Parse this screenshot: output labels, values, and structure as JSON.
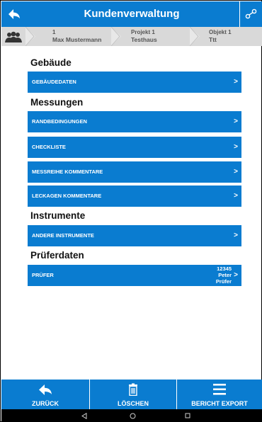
{
  "header": {
    "title": "Kundenverwaltung",
    "back_icon": "arrow-left-icon",
    "share_icon": "share-icon"
  },
  "breadcrumb": {
    "items": [
      {
        "num": "1",
        "name": "Max Mustermann"
      },
      {
        "num": "Projekt 1",
        "name": "Testhaus"
      },
      {
        "num": "Objekt 1",
        "name": "Ttt"
      }
    ]
  },
  "sections": [
    {
      "title": "Gebäude",
      "items": [
        {
          "label": "GEBÄUDEDATEN",
          "arrow": ">"
        }
      ]
    },
    {
      "title": "Messungen",
      "items": [
        {
          "label": "RANDBEDINGUNGEN",
          "arrow": ">"
        },
        {
          "label": "CHECKLISTE",
          "arrow": ">"
        },
        {
          "label": "MESSREIHE KOMMENTARE",
          "arrow": ">"
        },
        {
          "label": "LECKAGEN KOMMENTARE",
          "arrow": ">"
        }
      ]
    },
    {
      "title": "Instrumente",
      "items": [
        {
          "label": "ANDERE INSTRUMENTE",
          "arrow": ">"
        }
      ]
    },
    {
      "title": "Prüferdaten",
      "items": [
        {
          "label": "PRÜFER",
          "arrow": ">",
          "extra": [
            "12345",
            "Peter",
            "Prüfer"
          ]
        }
      ]
    }
  ],
  "bottom_bar": {
    "back_label": "ZURÜCK",
    "delete_label": "LÖSCHEN",
    "export_label": "BERICHT EXPORT"
  },
  "colors": {
    "primary": "#0a7cd0",
    "breadcrumb_bg": "#d9d9d9"
  }
}
